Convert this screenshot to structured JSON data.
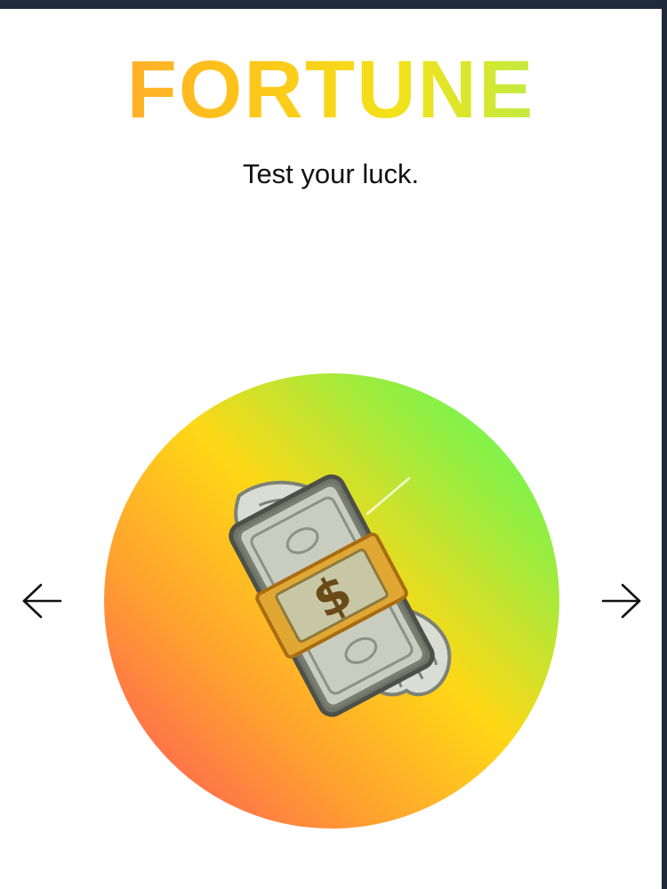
{
  "app": {
    "title": "FORTUNE",
    "subtitle": "Test your luck."
  },
  "carousel": {
    "current_item_icon": "money-with-wings-icon",
    "prev_icon": "arrow-left-icon",
    "next_icon": "arrow-right-icon"
  },
  "colors": {
    "title_gradient": [
      "#ff9a3c",
      "#ffc21a",
      "#f3e21a",
      "#b8ec48",
      "#9cf04f"
    ],
    "circle_gradient": [
      "#4dff5c",
      "#9cec40",
      "#ffd716",
      "#ffa030",
      "#ff4d5f"
    ],
    "frame": "#1f2a3a"
  }
}
